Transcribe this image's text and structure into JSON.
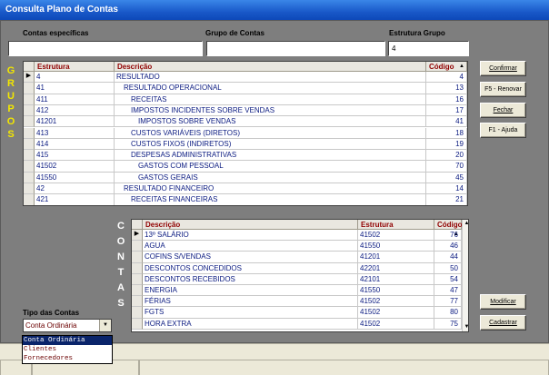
{
  "window": {
    "title": "Consulta Plano de Contas"
  },
  "filters": {
    "contas_especificas": {
      "label": "Contas específicas",
      "value": ""
    },
    "grupo_contas": {
      "label": "Grupo de Contas",
      "value": ""
    },
    "estrutura_grupo": {
      "label": "Estrutura Grupo",
      "value": "4"
    }
  },
  "side_labels": {
    "grupos": [
      "G",
      "R",
      "U",
      "P",
      "O",
      "S"
    ],
    "contas": [
      "C",
      "O",
      "N",
      "T",
      "A",
      "S"
    ]
  },
  "grupos_table": {
    "headers": [
      "Estrutura",
      "Descrição",
      "Código"
    ],
    "sort_indicator": "▲",
    "rows": [
      {
        "estrutura": "4",
        "descricao": "RESULTADO",
        "codigo": "4"
      },
      {
        "estrutura": "41",
        "descricao": "RESULTADO OPERACIONAL",
        "codigo": "13"
      },
      {
        "estrutura": "411",
        "descricao": "RECEITAS",
        "codigo": "16"
      },
      {
        "estrutura": "412",
        "descricao": "IMPOSTOS INCIDENTES SOBRE VENDAS",
        "codigo": "17"
      },
      {
        "estrutura": "41201",
        "descricao": "IMPOSTOS SOBRE VENDAS",
        "codigo": "41"
      },
      {
        "estrutura": "413",
        "descricao": "CUSTOS VARIÁVEIS (DIRETOS)",
        "codigo": "18"
      },
      {
        "estrutura": "414",
        "descricao": "CUSTOS FIXOS (INDIRETOS)",
        "codigo": "19"
      },
      {
        "estrutura": "415",
        "descricao": "DESPESAS ADMINISTRATIVAS",
        "codigo": "20"
      },
      {
        "estrutura": "41502",
        "descricao": "GASTOS COM PESSOAL",
        "codigo": "70"
      },
      {
        "estrutura": "41550",
        "descricao": "GASTOS GERAIS",
        "codigo": "45"
      },
      {
        "estrutura": "42",
        "descricao": "RESULTADO FINANCEIRO",
        "codigo": "14"
      },
      {
        "estrutura": "421",
        "descricao": "RECEITAS FINANCEIRAS",
        "codigo": "21"
      }
    ]
  },
  "contas_table": {
    "headers": [
      "Descrição",
      "Estrutura",
      "Código"
    ],
    "sort_indicator": "▲",
    "rows": [
      {
        "descricao": "13º SALÁRIO",
        "estrutura": "41502",
        "codigo": "76"
      },
      {
        "descricao": "AGUA",
        "estrutura": "41550",
        "codigo": "46"
      },
      {
        "descricao": "COFINS S/VENDAS",
        "estrutura": "41201",
        "codigo": "44"
      },
      {
        "descricao": "DESCONTOS CONCEDIDOS",
        "estrutura": "42201",
        "codigo": "50"
      },
      {
        "descricao": "DESCONTOS RECEBIDOS",
        "estrutura": "42101",
        "codigo": "54"
      },
      {
        "descricao": "ENERGIA",
        "estrutura": "41550",
        "codigo": "47"
      },
      {
        "descricao": "FÉRIAS",
        "estrutura": "41502",
        "codigo": "77"
      },
      {
        "descricao": "FGTS",
        "estrutura": "41502",
        "codigo": "80"
      },
      {
        "descricao": "HORA EXTRA",
        "estrutura": "41502",
        "codigo": "75"
      }
    ]
  },
  "buttons": {
    "confirmar": "Confirmar",
    "renovar": "F5 - Renovar",
    "fechar": "Fechar",
    "ajuda": "F1 - Ajuda",
    "modificar": "Modificar",
    "cadastrar": "Cadastrar"
  },
  "tipo_contas": {
    "label": "Tipo das Contas",
    "selected": "Conta Ordinária",
    "options": [
      "Conta Ordinária",
      "Clientes",
      "Fornecedores"
    ]
  },
  "colors": {
    "title_bar": "#1959c9",
    "panel": "#7e7e7e",
    "header_text": "#900000",
    "cell_text": "#0a1a80",
    "grupos_letters": "#f2e600",
    "contas_letters": "#ffffff"
  }
}
